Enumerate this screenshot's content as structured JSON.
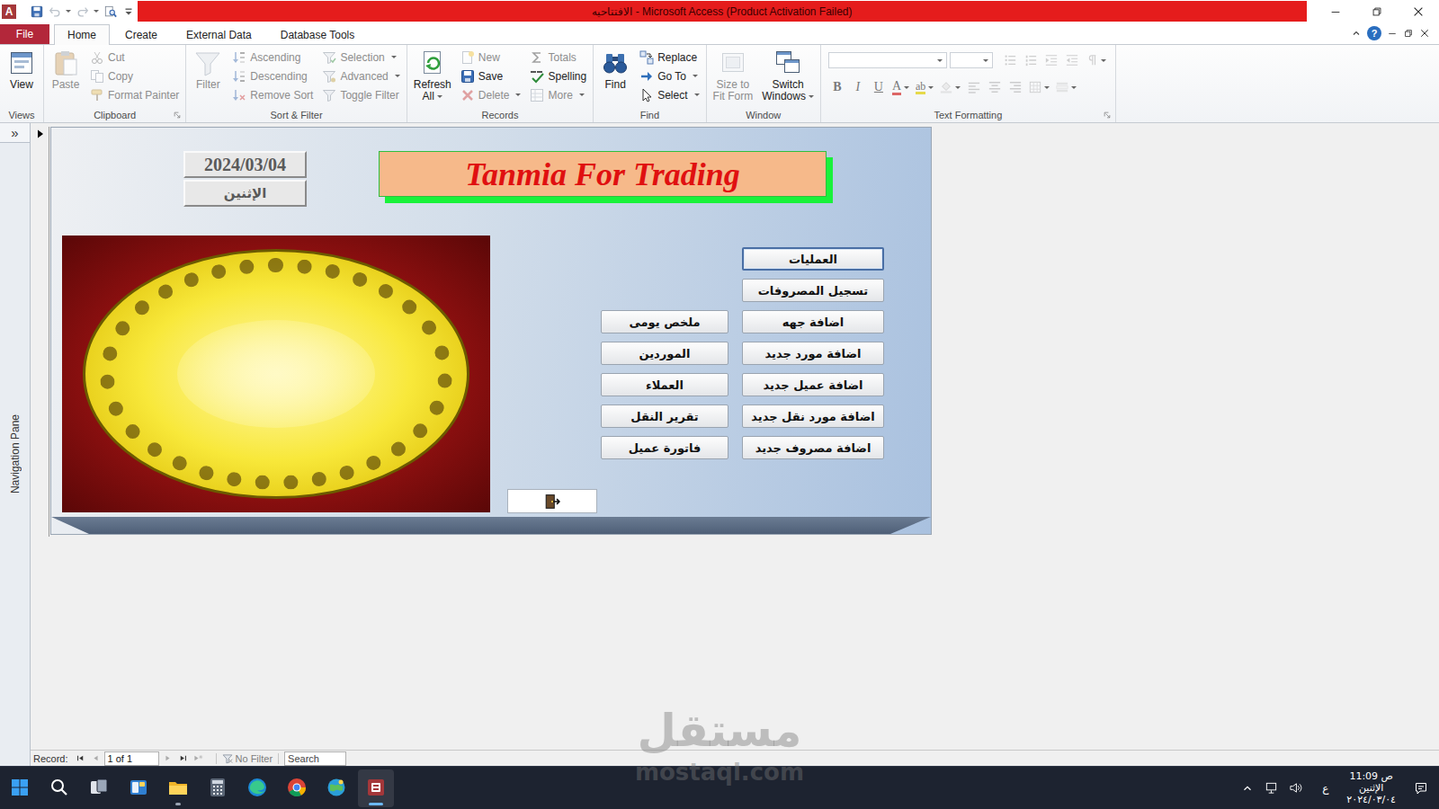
{
  "window": {
    "title": "الافتتاحيه  -  Microsoft Access (Product Activation Failed)",
    "logo": "A",
    "help": "?"
  },
  "quick_access": [
    {
      "kind": "save",
      "disabled": false,
      "dropdown": false
    },
    {
      "kind": "undo",
      "disabled": true,
      "dropdown": true
    },
    {
      "kind": "redo",
      "disabled": true,
      "dropdown": true
    },
    {
      "kind": "preview",
      "disabled": false,
      "dropdown": false
    },
    {
      "kind": "customize",
      "disabled": false,
      "dropdown": false
    }
  ],
  "ribbon_tabs": [
    {
      "label": "File",
      "selected": false,
      "kind": "file"
    },
    {
      "label": "Home",
      "selected": true,
      "kind": "tab"
    },
    {
      "label": "Create",
      "selected": false,
      "kind": "tab"
    },
    {
      "label": "External Data",
      "selected": false,
      "kind": "tab"
    },
    {
      "label": "Database Tools",
      "selected": false,
      "kind": "tab"
    }
  ],
  "ribbon_groups": [
    {
      "label": "Views",
      "launcher": false,
      "large": [
        {
          "lines": [
            "View"
          ],
          "kind": "view",
          "disabled": false,
          "dropdown": false
        }
      ],
      "columns": []
    },
    {
      "label": "Clipboard",
      "launcher": true,
      "large": [
        {
          "lines": [
            "Paste"
          ],
          "kind": "paste",
          "disabled": true,
          "dropdown": false
        }
      ],
      "columns": [
        [
          {
            "label": "Cut",
            "kind": "cut",
            "disabled": true,
            "dropdown": false
          },
          {
            "label": "Copy",
            "kind": "copy",
            "disabled": true,
            "dropdown": false
          },
          {
            "label": "Format Painter",
            "kind": "painter",
            "disabled": true,
            "dropdown": false
          }
        ]
      ]
    },
    {
      "label": "Sort & Filter",
      "launcher": false,
      "large": [
        {
          "lines": [
            "Filter"
          ],
          "kind": "filter",
          "disabled": true,
          "dropdown": false
        }
      ],
      "columns": [
        [
          {
            "label": "Ascending",
            "kind": "asc",
            "disabled": true,
            "dropdown": false
          },
          {
            "label": "Descending",
            "kind": "desc",
            "disabled": true,
            "dropdown": false
          },
          {
            "label": "Remove Sort",
            "kind": "removesort",
            "disabled": true,
            "dropdown": false
          }
        ],
        [
          {
            "label": "Selection",
            "kind": "selection",
            "disabled": true,
            "dropdown": true
          },
          {
            "label": "Advanced",
            "kind": "advanced",
            "disabled": true,
            "dropdown": true
          },
          {
            "label": "Toggle Filter",
            "kind": "toggle",
            "disabled": true,
            "dropdown": false
          }
        ]
      ]
    },
    {
      "label": "Records",
      "launcher": false,
      "large": [
        {
          "lines": [
            "Refresh",
            "All"
          ],
          "kind": "refresh",
          "disabled": false,
          "dropdown": true
        }
      ],
      "columns": [
        [
          {
            "label": "New",
            "kind": "new",
            "disabled": true,
            "dropdown": false
          },
          {
            "label": "Save",
            "kind": "save",
            "disabled": false,
            "dropdown": false
          },
          {
            "label": "Delete",
            "kind": "delete",
            "disabled": true,
            "dropdown": true
          }
        ],
        [
          {
            "label": "Totals",
            "kind": "totals",
            "disabled": true,
            "dropdown": false
          },
          {
            "label": "Spelling",
            "kind": "spelling",
            "disabled": false,
            "dropdown": false
          },
          {
            "label": "More",
            "kind": "more",
            "disabled": true,
            "dropdown": true
          }
        ]
      ]
    },
    {
      "label": "Find",
      "launcher": false,
      "large": [
        {
          "lines": [
            "Find"
          ],
          "kind": "find",
          "disabled": false,
          "dropdown": false
        }
      ],
      "columns": [
        [
          {
            "label": "Replace",
            "kind": "replace",
            "disabled": false,
            "dropdown": false
          },
          {
            "label": "Go To",
            "kind": "goto",
            "disabled": false,
            "dropdown": true
          },
          {
            "label": "Select",
            "kind": "select",
            "disabled": false,
            "dropdown": true
          }
        ]
      ]
    },
    {
      "label": "Window",
      "launcher": false,
      "large": [
        {
          "lines": [
            "Size to",
            "Fit Form"
          ],
          "kind": "fit",
          "disabled": true,
          "dropdown": false
        },
        {
          "lines": [
            "Switch",
            "Windows"
          ],
          "kind": "switch",
          "disabled": false,
          "dropdown": true
        }
      ],
      "columns": []
    }
  ],
  "text_formatting": {
    "label": "Text Formatting",
    "launcher": true,
    "disabled": true,
    "row1": [
      {
        "kind": "bullets",
        "dropdown": false
      },
      {
        "kind": "numbering",
        "dropdown": false
      },
      {
        "kind": "indent",
        "dropdown": false
      },
      {
        "kind": "outdent",
        "dropdown": false
      },
      {
        "kind": "para",
        "dropdown": true
      }
    ],
    "row2": [
      {
        "kind": "bold",
        "glyph": "B",
        "dropdown": false
      },
      {
        "kind": "italic",
        "glyph": "I",
        "dropdown": false
      },
      {
        "kind": "underline",
        "glyph": "U",
        "dropdown": false
      },
      {
        "kind": "fontcolor",
        "glyph": "A",
        "dropdown": true
      },
      {
        "kind": "highlight",
        "glyph": "ab",
        "dropdown": true
      },
      {
        "kind": "fill",
        "dropdown": true
      },
      {
        "kind": "alignleft",
        "dropdown": false
      },
      {
        "kind": "aligncenter",
        "dropdown": false
      },
      {
        "kind": "alignright",
        "dropdown": false
      },
      {
        "kind": "gridlines",
        "dropdown": true
      },
      {
        "kind": "altrow",
        "dropdown": true
      }
    ]
  },
  "nav_pane": {
    "toggle": "»",
    "label": "Navigation Pane"
  },
  "form": {
    "date": "2024/03/04",
    "day": "الإثنين",
    "title": "Tanmia For Trading",
    "right_buttons": [
      {
        "label": "العمليات",
        "focused": true
      },
      {
        "label": "تسجيل المصروفات",
        "focused": false
      },
      {
        "label": "اضافة جهه",
        "focused": false
      },
      {
        "label": "اضافة مورد جديد",
        "focused": false
      },
      {
        "label": "اضافة عميل جديد",
        "focused": false
      },
      {
        "label": "اضافة مورد نقل جديد",
        "focused": false
      },
      {
        "label": "اضافة مصروف جديد",
        "focused": false
      }
    ],
    "left_buttons": [
      {
        "label": "ملخص يومى",
        "focused": false
      },
      {
        "label": "الموردين",
        "focused": false
      },
      {
        "label": "العملاء",
        "focused": false
      },
      {
        "label": "تقرير النقل",
        "focused": false
      },
      {
        "label": "فاتورة عميل",
        "focused": false
      }
    ]
  },
  "record_bar": {
    "label": "Record:",
    "position": "1 of 1",
    "filter": "No Filter",
    "search": "Search"
  },
  "taskbar": {
    "apps": [
      {
        "kind": "start",
        "active": false,
        "running": false
      },
      {
        "kind": "search",
        "active": false,
        "running": false
      },
      {
        "kind": "taskview",
        "active": false,
        "running": false
      },
      {
        "kind": "widgets",
        "active": false,
        "running": false
      },
      {
        "kind": "explorer",
        "active": false,
        "running": true
      },
      {
        "kind": "calculator",
        "active": false,
        "running": false
      },
      {
        "kind": "edge",
        "active": false,
        "running": false
      },
      {
        "kind": "chrome",
        "active": false,
        "running": false
      },
      {
        "kind": "globe",
        "active": false,
        "running": false
      },
      {
        "kind": "access",
        "active": true,
        "running": true
      }
    ],
    "lang": "ع",
    "time": "11:09 ص",
    "day": "الإثنين",
    "date": "٢٠٢٤/٠٣/٠٤"
  },
  "watermark": {
    "arabic": "مستقل",
    "latin": "mostaql.com"
  }
}
